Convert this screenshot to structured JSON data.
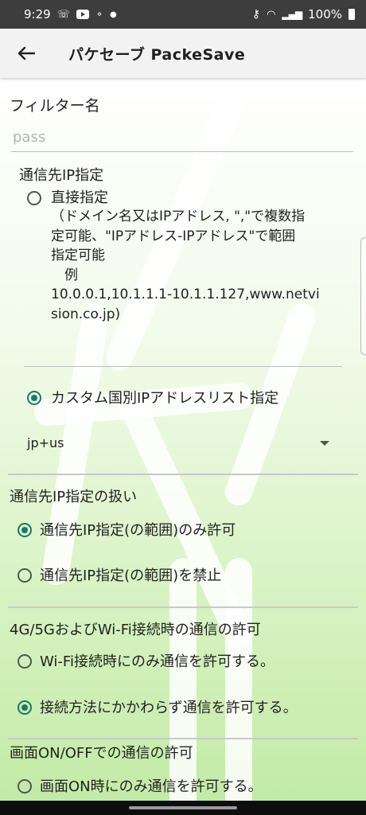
{
  "status_bar": {
    "time": "9:29",
    "battery": "100%"
  },
  "app_bar": {
    "title": "パケセーブ  PackeSave"
  },
  "form": {
    "filter_label": "フィルター名",
    "filter_placeholder": "pass",
    "ip_section": {
      "title": "通信先IP指定",
      "direct_label": "直接指定",
      "direct_desc_1": "（ドメイン名又はIPアドレス, \",\"で複数指",
      "direct_desc_2": "定可能、\"IPアドレス-IPアドレス\"で範囲",
      "direct_desc_3": "指定可能",
      "direct_desc_4": "　例",
      "direct_desc_5": "10.0.0.1,10.1.1.1-10.1.1.127,www.netvi",
      "direct_desc_6": "sion.co.jp)",
      "custom_label": "カスタム国別IPアドレスリスト指定",
      "custom_value": "jp+us"
    },
    "handling": {
      "title": "通信先IP指定の扱い",
      "opt_allow": "通信先IP指定(の範囲)のみ許可",
      "opt_block": "通信先IP指定(の範囲)を禁止"
    },
    "network": {
      "title": "4G/5GおよびWi-Fi接続時の通信の許可",
      "opt_wifi": "Wi-Fi接続時にのみ通信を許可する。",
      "opt_any": "接続方法にかかわらず通信を許可する。"
    },
    "screen": {
      "title": "画面ON/OFFでの通信の許可",
      "opt_on": "画面ON時にのみ通信を許可する。"
    }
  },
  "colors": {
    "accent": "#1a7a68",
    "status_bar": "#3d3d3d",
    "app_bar": "#f2f2f2"
  }
}
